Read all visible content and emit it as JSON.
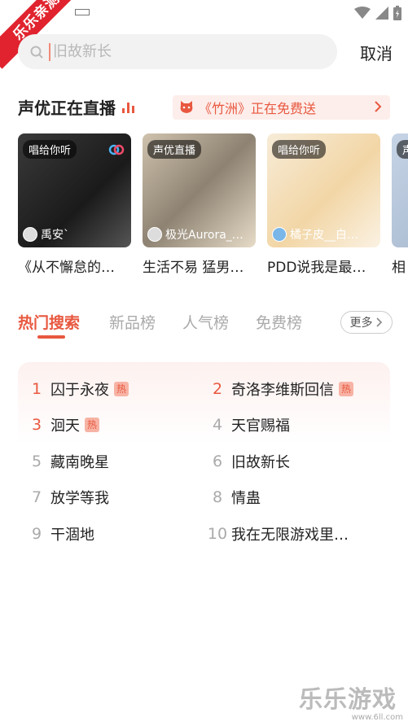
{
  "corner_badge": "乐乐亲测",
  "search": {
    "placeholder": "旧故新长",
    "cancel_label": "取消"
  },
  "live_section": {
    "title": "声优正在直播",
    "banner_text": "《竹洲》正在免费送",
    "cards": [
      {
        "tag": "唱给你听",
        "host": "禹安`",
        "caption": "《从不懈怠的…"
      },
      {
        "tag": "声优直播",
        "host": "极光Aurora_…",
        "caption": "生活不易 猛男…"
      },
      {
        "tag": "唱给你听",
        "host": "橘子皮__白…",
        "caption": "PDD说我是最…"
      },
      {
        "tag": "声",
        "host": "",
        "caption": "相"
      }
    ]
  },
  "tabs": [
    {
      "label": "热门搜索",
      "active": true
    },
    {
      "label": "新品榜",
      "active": false
    },
    {
      "label": "人气榜",
      "active": false
    },
    {
      "label": "免费榜",
      "active": false
    }
  ],
  "more_label": "更多",
  "hot_label": "热",
  "ranking": [
    {
      "rank": "1",
      "title": "囚于永夜",
      "hot": true
    },
    {
      "rank": "2",
      "title": "奇洛李维斯回信",
      "hot": true
    },
    {
      "rank": "3",
      "title": "洄天",
      "hot": true
    },
    {
      "rank": "4",
      "title": "天官赐福",
      "hot": false
    },
    {
      "rank": "5",
      "title": "藏南晚星",
      "hot": false
    },
    {
      "rank": "6",
      "title": "旧故新长",
      "hot": false
    },
    {
      "rank": "7",
      "title": "放学等我",
      "hot": false
    },
    {
      "rank": "8",
      "title": "情蛊",
      "hot": false
    },
    {
      "rank": "9",
      "title": "干涸地",
      "hot": false
    },
    {
      "rank": "10",
      "title": "我在无限游戏里…",
      "hot": false
    }
  ],
  "watermark": {
    "text": "乐乐游戏",
    "url": "www.6ll.com"
  },
  "colors": {
    "accent": "#e8583f",
    "badge": "#e0232e"
  }
}
